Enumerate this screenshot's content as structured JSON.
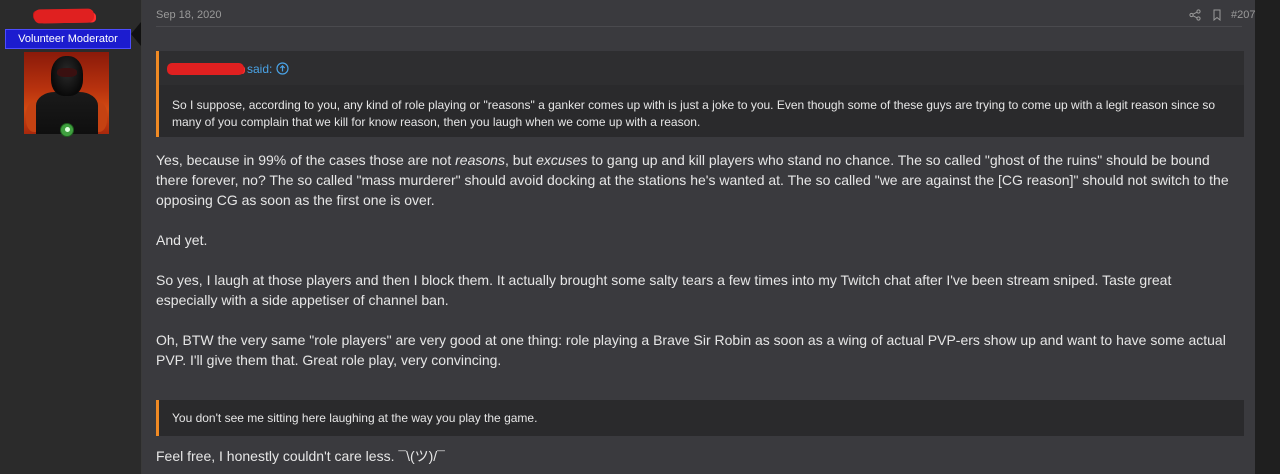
{
  "user": {
    "role_badge": "Volunteer Moderator"
  },
  "post": {
    "date": "Sep 18, 2020",
    "number": "#207",
    "icons": {
      "share": "share-icon",
      "bookmark": "bookmark-icon"
    },
    "quote1": {
      "said": "said:",
      "body": "So I suppose, according to you, any kind of role playing or \"reasons\" a ganker comes up with is just a joke to you. Even though some of these guys are trying to come up with a legit reason since so many of you complain that we kill for know reason, then you laugh when we come up with a reason."
    },
    "p1": {
      "a": "Yes, because in 99% of the cases those are not ",
      "b": "reasons",
      "c": ", but ",
      "d": "excuses",
      "e": " to gang up and kill players who stand no chance. The so called \"ghost of the ruins\" should be bound there forever, no? The so called \"mass murderer\" should avoid docking at the stations he's wanted at. The so called \"we are against the [CG reason]\" should not switch to the opposing CG as soon as the first one is over."
    },
    "p2": "And yet.",
    "p3": "So yes, I laugh at those players and then I block them. It actually brought some salty tears a few times into my Twitch chat after I've been stream sniped. Taste great especially with a side appetiser of channel ban.",
    "p4": "Oh, BTW the very same \"role players\" are very good at one thing: role playing a Brave Sir Robin as soon as a wing of actual PVP-ers show up and want to have some actual PVP. I'll give them that. Great role play, very convincing.",
    "quote2": "You don't see me sitting here laughing at the way you play the game.",
    "p5": "Feel free, I honestly couldn't care less. ¯\\(ツ)/¯"
  },
  "colors": {
    "accent_quote": "#f08a24",
    "link": "#4aa3e6",
    "badge": "#1c1ccf",
    "redaction": "#e02020"
  }
}
